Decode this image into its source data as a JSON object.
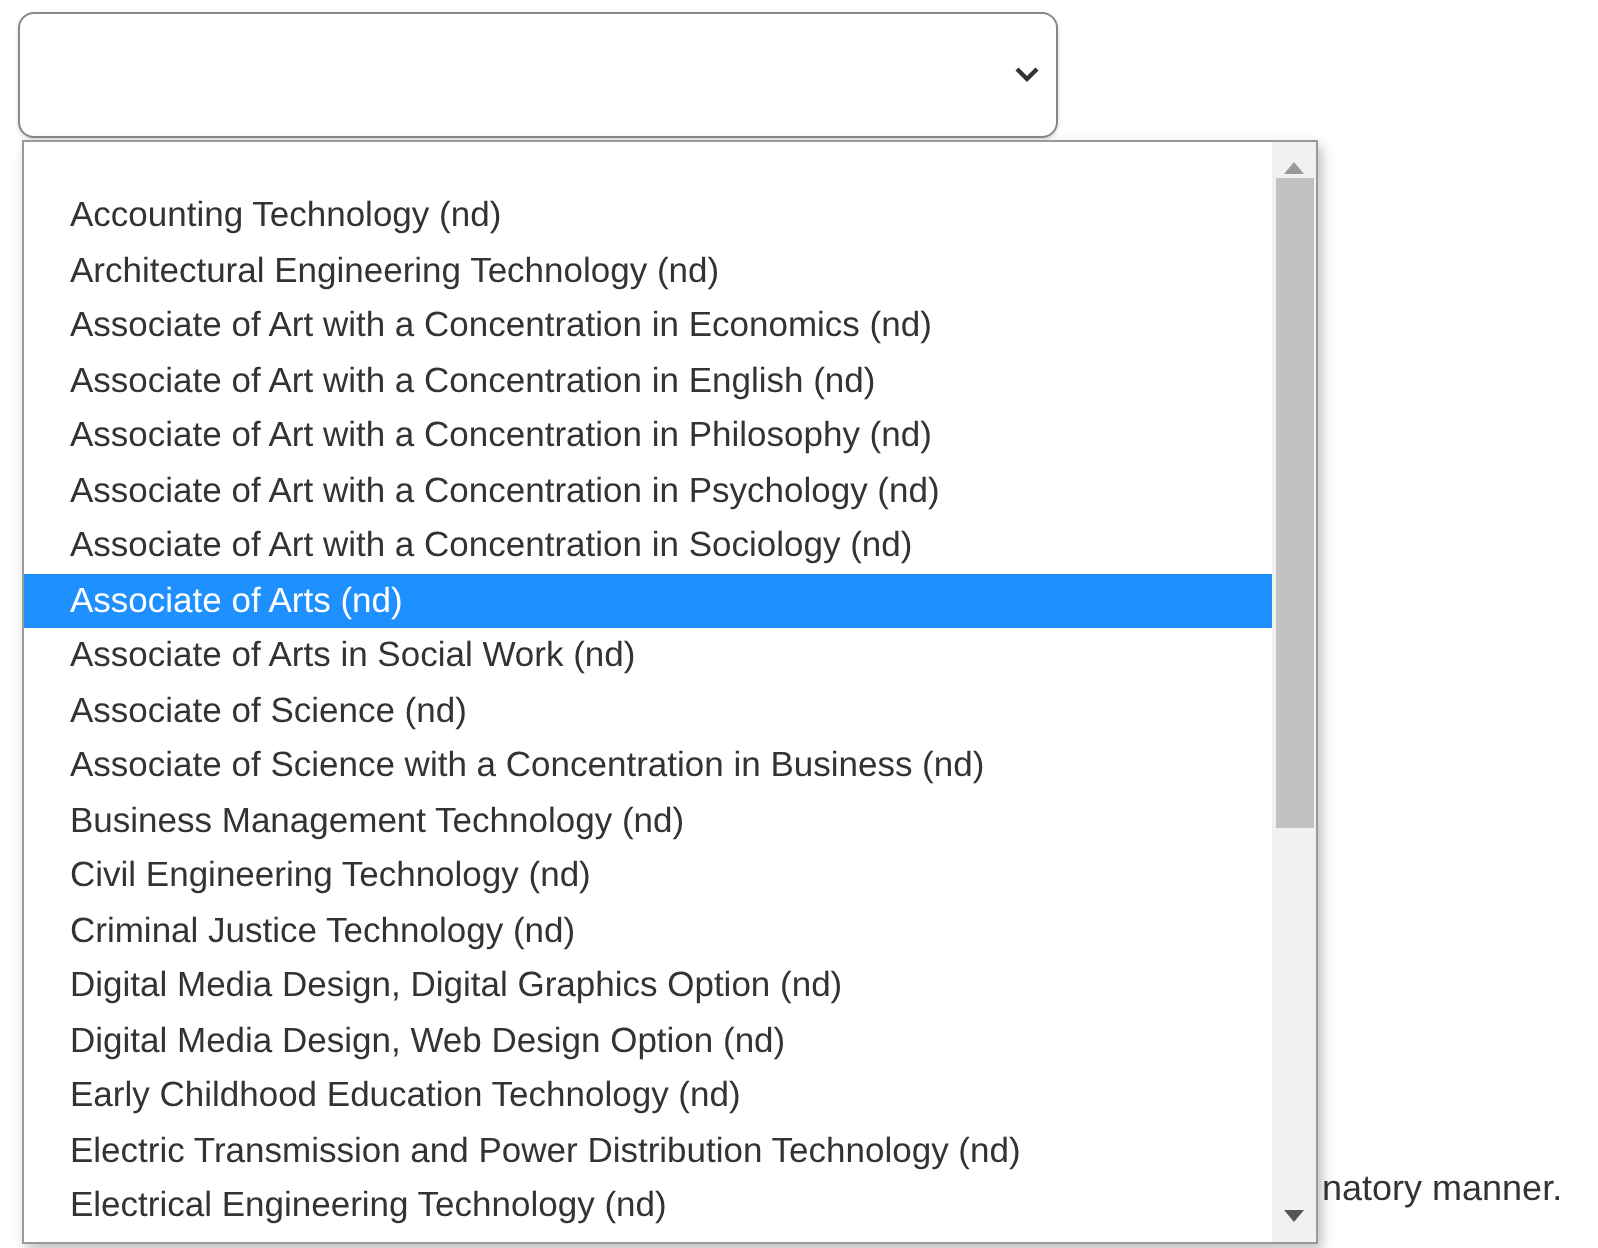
{
  "select": {
    "expanded": true
  },
  "options": [
    {
      "label": "Accounting Technology (nd)",
      "selected": false
    },
    {
      "label": "Architectural Engineering Technology (nd)",
      "selected": false
    },
    {
      "label": "Associate of Art with a Concentration in Economics (nd)",
      "selected": false
    },
    {
      "label": "Associate of Art with a Concentration in English (nd)",
      "selected": false
    },
    {
      "label": "Associate of Art with a Concentration in Philosophy (nd)",
      "selected": false
    },
    {
      "label": "Associate of Art with a Concentration in Psychology (nd)",
      "selected": false
    },
    {
      "label": "Associate of Art with a Concentration in Sociology (nd)",
      "selected": false
    },
    {
      "label": "Associate of Arts (nd)",
      "selected": true
    },
    {
      "label": "Associate of Arts in Social Work (nd)",
      "selected": false
    },
    {
      "label": "Associate of Science (nd)",
      "selected": false
    },
    {
      "label": "Associate of Science with a Concentration in Business (nd)",
      "selected": false
    },
    {
      "label": "Business Management Technology (nd)",
      "selected": false
    },
    {
      "label": "Civil Engineering Technology (nd)",
      "selected": false
    },
    {
      "label": "Criminal Justice Technology (nd)",
      "selected": false
    },
    {
      "label": "Digital Media Design, Digital Graphics Option (nd)",
      "selected": false
    },
    {
      "label": "Digital Media Design, Web Design Option (nd)",
      "selected": false
    },
    {
      "label": "Early Childhood Education Technology (nd)",
      "selected": false
    },
    {
      "label": "Electric Transmission and Power Distribution Technology (nd)",
      "selected": false
    },
    {
      "label": "Electrical Engineering Technology (nd)",
      "selected": false
    }
  ],
  "background_text": "natory manner."
}
